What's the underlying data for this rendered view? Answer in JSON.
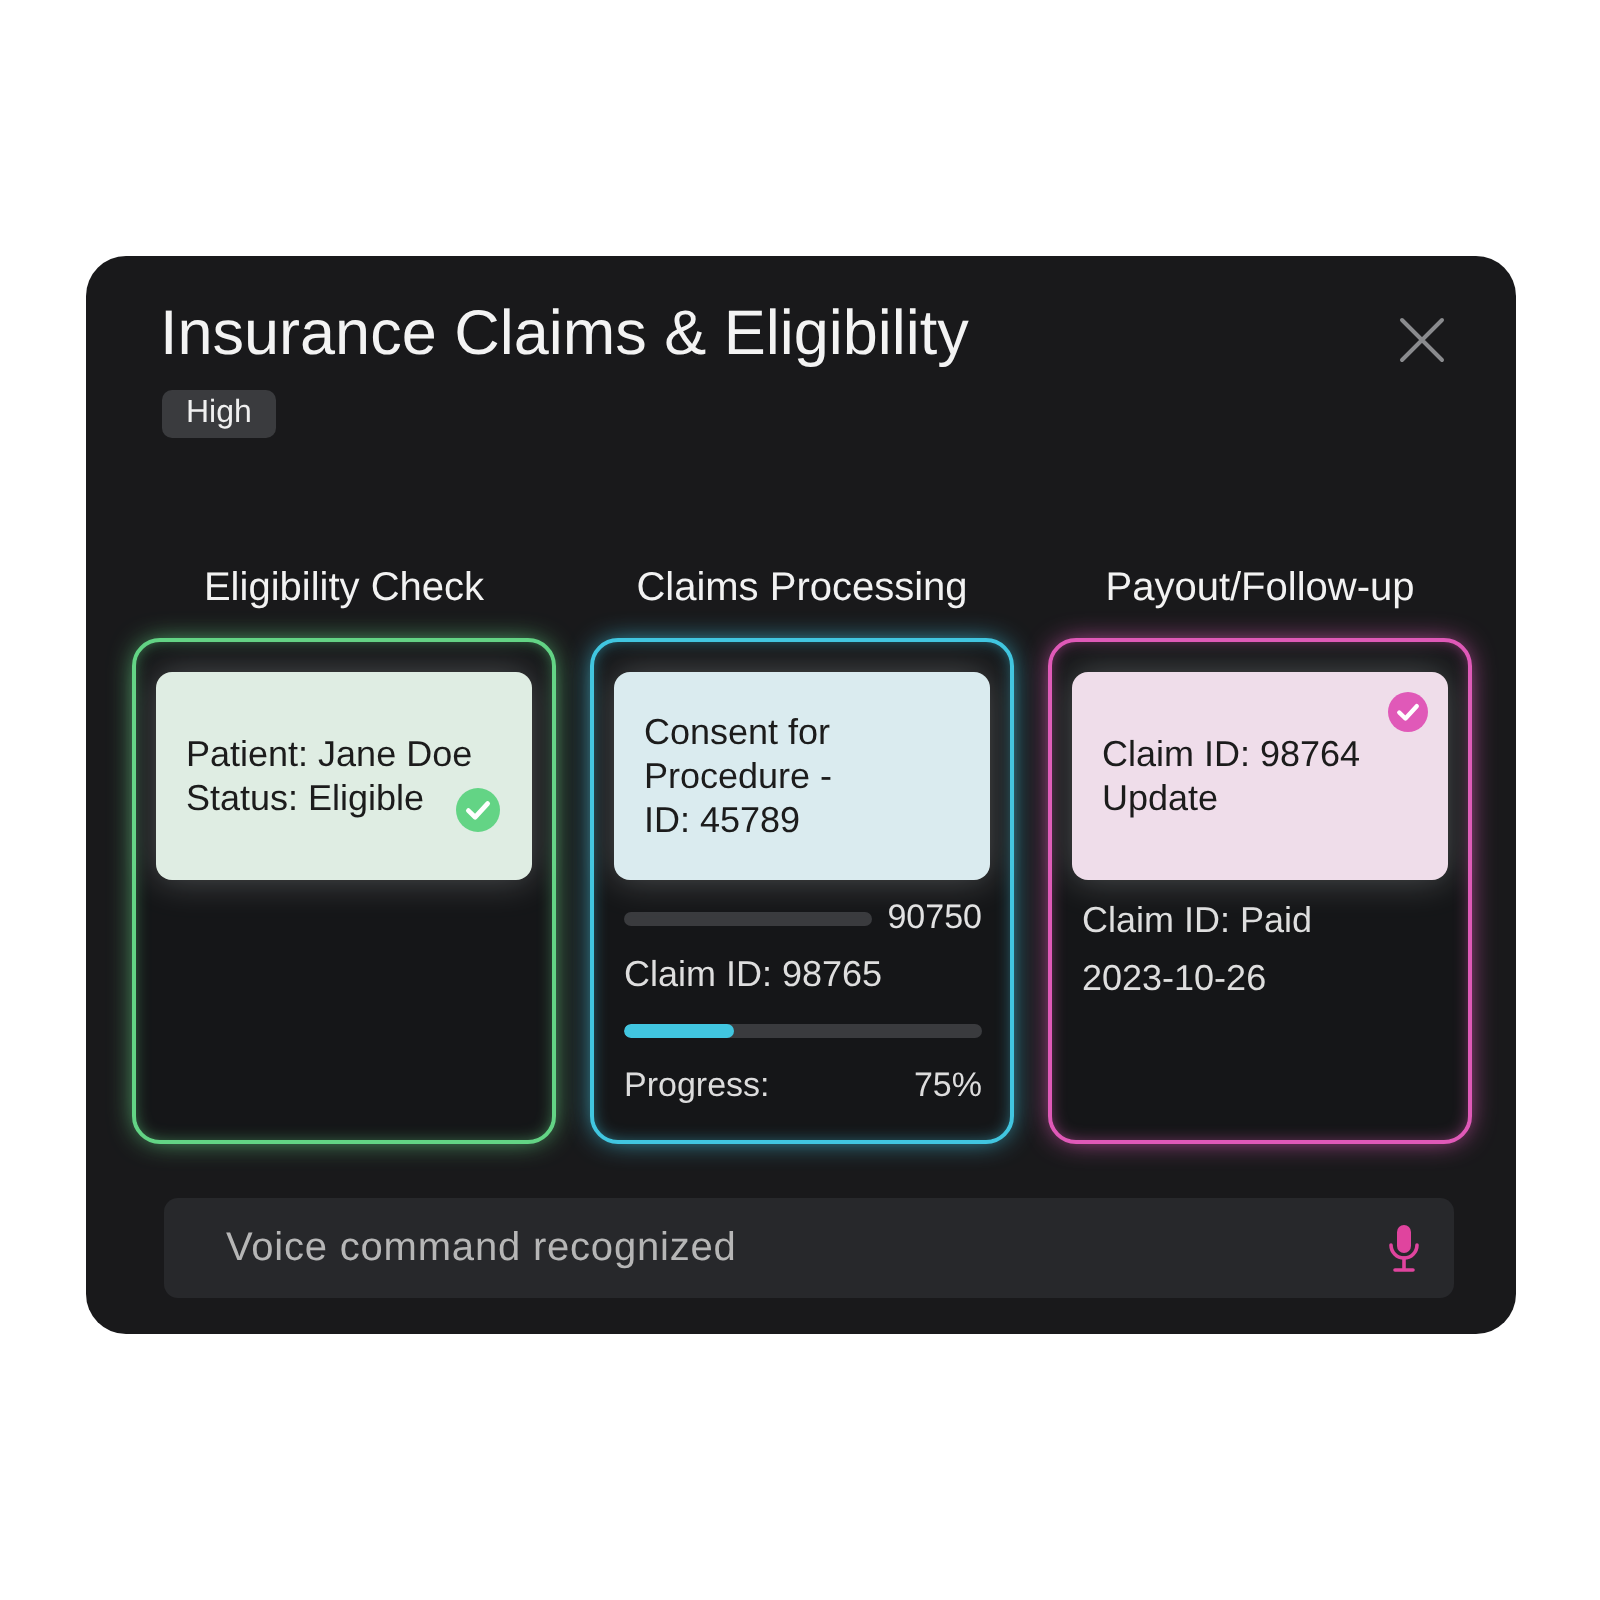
{
  "dialog": {
    "title": "Insurance Claims & Eligibility",
    "badge": "High"
  },
  "columns": [
    {
      "heading": "Eligibility Check",
      "color": "#63d485",
      "card": {
        "checked": false,
        "lines": [
          {
            "text": "Patient: Jane Doe",
            "checked": false
          },
          {
            "text": "Status: Eligible",
            "checked": true
          }
        ]
      }
    },
    {
      "heading": "Claims Processing",
      "color": "#41c6e0",
      "card": {
        "checked": false,
        "lines": [
          {
            "text": "Consent for",
            "checked": false
          },
          {
            "text": "Procedure -",
            "checked": false
          },
          {
            "text": "ID: 45789",
            "checked": false
          }
        ]
      },
      "details": [
        {
          "kind": "bar",
          "reading": "90750"
        },
        {
          "kind": "text",
          "text": "Claim ID: 98765"
        },
        {
          "kind": "meter",
          "level": 0.31
        },
        {
          "kind": "pair",
          "label": "Progress:",
          "reading": "75%"
        }
      ]
    },
    {
      "heading": "Payout/Follow-up",
      "color": "#e059b8",
      "card": {
        "checked": true,
        "lines": [
          {
            "text": "Claim ID: 98764",
            "checked": false
          },
          {
            "text": "Update",
            "checked": false
          }
        ]
      },
      "details": [
        {
          "kind": "text",
          "text": "Claim ID: Paid"
        },
        {
          "kind": "text",
          "text": "2023-10-26"
        }
      ]
    }
  ],
  "voice_input": {
    "placeholder": "Voice command recognized"
  }
}
